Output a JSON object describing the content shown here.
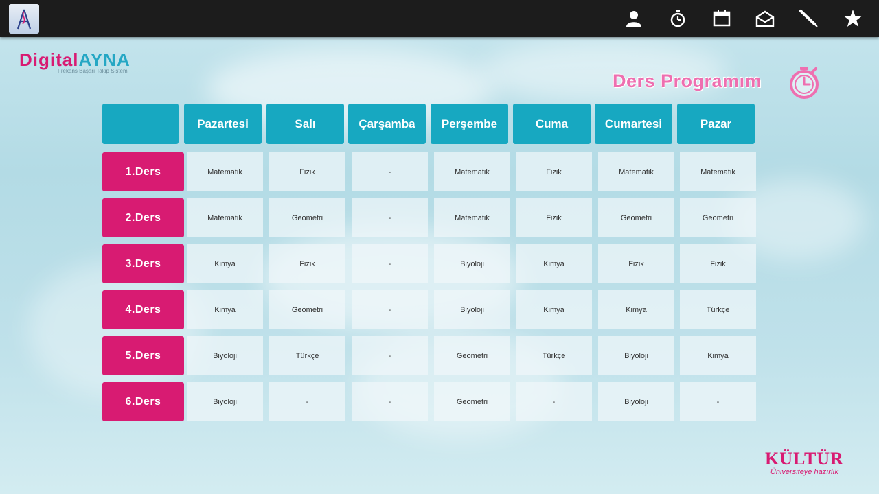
{
  "topbar": {
    "icons": [
      "profile-icon",
      "stopwatch-icon",
      "calendar-icon",
      "mail-icon",
      "pen-icon",
      "star-icon"
    ]
  },
  "brand": {
    "name_part1": "Digital",
    "name_part2": "AYNA",
    "subtitle": "Frekans Başarı Takip Sistemi"
  },
  "page": {
    "title": "Ders Programım"
  },
  "schedule": {
    "days": [
      "Pazartesi",
      "Salı",
      "Çarşamba",
      "Perşembe",
      "Cuma",
      "Cumartesi",
      "Pazar"
    ],
    "lessons": [
      {
        "label": "1.Ders",
        "slots": [
          "Matematik",
          "Fizik",
          "-",
          "Matematik",
          "Fizik",
          "Matematik",
          "Matematik"
        ]
      },
      {
        "label": "2.Ders",
        "slots": [
          "Matematik",
          "Geometri",
          "-",
          "Matematik",
          "Fizik",
          "Geometri",
          "Geometri"
        ]
      },
      {
        "label": "3.Ders",
        "slots": [
          "Kimya",
          "Fizik",
          "-",
          "Biyoloji",
          "Kimya",
          "Fizik",
          "Fizik"
        ]
      },
      {
        "label": "4.Ders",
        "slots": [
          "Kimya",
          "Geometri",
          "-",
          "Biyoloji",
          "Kimya",
          "Kimya",
          "Türkçe"
        ]
      },
      {
        "label": "5.Ders",
        "slots": [
          "Biyoloji",
          "Türkçe",
          "-",
          "Geometri",
          "Türkçe",
          "Biyoloji",
          "Kimya"
        ]
      },
      {
        "label": "6.Ders",
        "slots": [
          "Biyoloji",
          "-",
          "-",
          "Geometri",
          "-",
          "Biyoloji",
          "-"
        ]
      }
    ]
  },
  "footer": {
    "logo_main": "KÜLTÜR",
    "logo_sub": "Üniversiteye hazırlık"
  },
  "colors": {
    "header_teal": "#17a8c1",
    "lesson_pink": "#d81b72",
    "title_pink": "#ee6fb0"
  }
}
